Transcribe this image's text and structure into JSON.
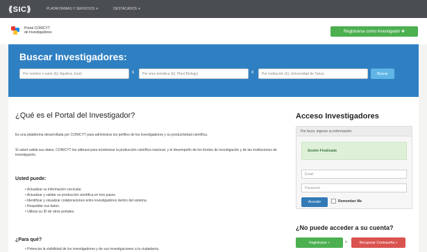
{
  "topnav": {
    "logo": "⟪SIC⟫",
    "items": [
      "PLATAFORMAS Y SERVICIOS",
      "DESTACADOS"
    ],
    "caret": "▾"
  },
  "header": {
    "brand_line1": "Portal CONICYT",
    "brand_line2": "de Investigadores",
    "register_button": "Registrarse como Investigador ✚"
  },
  "search": {
    "title": "Buscar Investigadores:",
    "author_placeholder": "Por nombre o autor (Ej: Aguilera José)",
    "area_placeholder": "Por área temática (Ej: Plant Biology)",
    "institution_placeholder": "Por institución (Ej: Universidad de Talca)",
    "separator": "ó",
    "button": "Buscar"
  },
  "main": {
    "heading": "¿Qué es el Portal del Investigador?",
    "paragraph1": "Es una plataforma desarrollada por CONICYT para administrar los perfiles de los investigadores y su productividad científica.",
    "paragraph2": "Si usted valida sus datos, CONICYT los utilizará para monitorear la producción científica nacional, y el desempeño de los fondos de investigación y de las instituciones de investigación.",
    "can_heading": "Usted puede:",
    "can_items": [
      "Actualizar su información curricular.",
      "Actualizar y validar su producción científica en tres pasos.",
      "Identificar y visualizar colaboraciones entre investigadores dentro del sistema.",
      "Respaldar sus datos.",
      "Utilizar su ID de otros portales."
    ],
    "for_heading": "¿Para qué?",
    "for_items": [
      "Potenciar la visibilidad de los investigadores y de sus investigaciones a la ciudadanía."
    ]
  },
  "access": {
    "title": "Acceso Investigadores",
    "box_heading": "Por favor, ingrese su información:",
    "session_message": "Sesión Finalizada",
    "email_placeholder": "Email",
    "password_placeholder": "Password",
    "login_button": "Acceder",
    "remember_label": "Remember Me",
    "cant_title": "¿No puede acceder a su cuenta?",
    "register_button": "Registrarse »",
    "or_label": "ó",
    "recover_button": "Recuperar Contraseña »"
  },
  "colors": {
    "topnav": "#4a4d52",
    "search_band": "#2f80c2",
    "success": "#4caf50",
    "primary": "#337ab7",
    "danger": "#d9534f"
  }
}
